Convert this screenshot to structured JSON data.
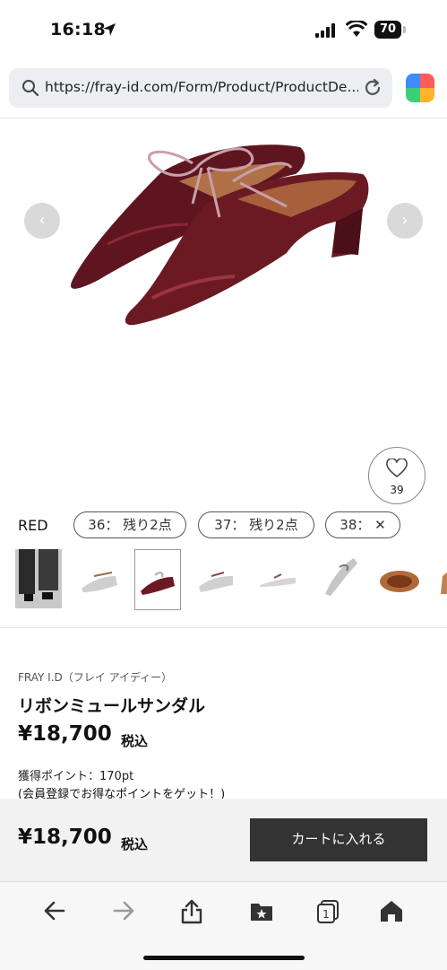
{
  "status_bar": {
    "time": "16:18",
    "battery": "70"
  },
  "browser": {
    "url": "https://fray-id.com/Form/Product/ProductDe..."
  },
  "gallery": {
    "favorite_count": "39"
  },
  "variants": {
    "color": "RED",
    "sizes": [
      {
        "label": "36： 残り2点"
      },
      {
        "label": "37： 残り2点"
      },
      {
        "label": "38： ✕"
      }
    ]
  },
  "product": {
    "brand": "FRAY I.D（フレイ アイディー）",
    "name": "リボンミュールサンダル",
    "price": "¥18,700",
    "tax_label": "税込",
    "points": "獲得ポイント：170pt",
    "points_link": "(会員登録でお得なポイントをゲット！)"
  },
  "cart": {
    "price": "¥18,700",
    "tax_label": "税込",
    "button_label": "カートに入れる"
  },
  "toolbar": {
    "icons": [
      "back-icon",
      "forward-icon",
      "share-icon",
      "bookmarks-icon",
      "tabs-icon",
      "home-icon"
    ]
  },
  "colors": {
    "accent": "#333333",
    "shoe": "#6b1a24"
  }
}
